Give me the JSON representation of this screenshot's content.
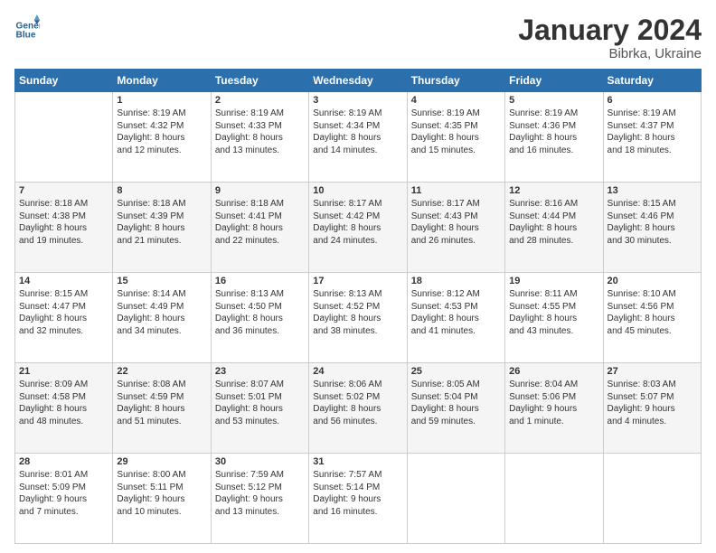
{
  "logo": {
    "line1": "General",
    "line2": "Blue"
  },
  "title": "January 2024",
  "subtitle": "Bibrka, Ukraine",
  "days_of_week": [
    "Sunday",
    "Monday",
    "Tuesday",
    "Wednesday",
    "Thursday",
    "Friday",
    "Saturday"
  ],
  "weeks": [
    [
      {
        "day": "",
        "content": ""
      },
      {
        "day": "1",
        "content": "Sunrise: 8:19 AM\nSunset: 4:32 PM\nDaylight: 8 hours\nand 12 minutes."
      },
      {
        "day": "2",
        "content": "Sunrise: 8:19 AM\nSunset: 4:33 PM\nDaylight: 8 hours\nand 13 minutes."
      },
      {
        "day": "3",
        "content": "Sunrise: 8:19 AM\nSunset: 4:34 PM\nDaylight: 8 hours\nand 14 minutes."
      },
      {
        "day": "4",
        "content": "Sunrise: 8:19 AM\nSunset: 4:35 PM\nDaylight: 8 hours\nand 15 minutes."
      },
      {
        "day": "5",
        "content": "Sunrise: 8:19 AM\nSunset: 4:36 PM\nDaylight: 8 hours\nand 16 minutes."
      },
      {
        "day": "6",
        "content": "Sunrise: 8:19 AM\nSunset: 4:37 PM\nDaylight: 8 hours\nand 18 minutes."
      }
    ],
    [
      {
        "day": "7",
        "content": "Sunrise: 8:18 AM\nSunset: 4:38 PM\nDaylight: 8 hours\nand 19 minutes."
      },
      {
        "day": "8",
        "content": "Sunrise: 8:18 AM\nSunset: 4:39 PM\nDaylight: 8 hours\nand 21 minutes."
      },
      {
        "day": "9",
        "content": "Sunrise: 8:18 AM\nSunset: 4:41 PM\nDaylight: 8 hours\nand 22 minutes."
      },
      {
        "day": "10",
        "content": "Sunrise: 8:17 AM\nSunset: 4:42 PM\nDaylight: 8 hours\nand 24 minutes."
      },
      {
        "day": "11",
        "content": "Sunrise: 8:17 AM\nSunset: 4:43 PM\nDaylight: 8 hours\nand 26 minutes."
      },
      {
        "day": "12",
        "content": "Sunrise: 8:16 AM\nSunset: 4:44 PM\nDaylight: 8 hours\nand 28 minutes."
      },
      {
        "day": "13",
        "content": "Sunrise: 8:15 AM\nSunset: 4:46 PM\nDaylight: 8 hours\nand 30 minutes."
      }
    ],
    [
      {
        "day": "14",
        "content": "Sunrise: 8:15 AM\nSunset: 4:47 PM\nDaylight: 8 hours\nand 32 minutes."
      },
      {
        "day": "15",
        "content": "Sunrise: 8:14 AM\nSunset: 4:49 PM\nDaylight: 8 hours\nand 34 minutes."
      },
      {
        "day": "16",
        "content": "Sunrise: 8:13 AM\nSunset: 4:50 PM\nDaylight: 8 hours\nand 36 minutes."
      },
      {
        "day": "17",
        "content": "Sunrise: 8:13 AM\nSunset: 4:52 PM\nDaylight: 8 hours\nand 38 minutes."
      },
      {
        "day": "18",
        "content": "Sunrise: 8:12 AM\nSunset: 4:53 PM\nDaylight: 8 hours\nand 41 minutes."
      },
      {
        "day": "19",
        "content": "Sunrise: 8:11 AM\nSunset: 4:55 PM\nDaylight: 8 hours\nand 43 minutes."
      },
      {
        "day": "20",
        "content": "Sunrise: 8:10 AM\nSunset: 4:56 PM\nDaylight: 8 hours\nand 45 minutes."
      }
    ],
    [
      {
        "day": "21",
        "content": "Sunrise: 8:09 AM\nSunset: 4:58 PM\nDaylight: 8 hours\nand 48 minutes."
      },
      {
        "day": "22",
        "content": "Sunrise: 8:08 AM\nSunset: 4:59 PM\nDaylight: 8 hours\nand 51 minutes."
      },
      {
        "day": "23",
        "content": "Sunrise: 8:07 AM\nSunset: 5:01 PM\nDaylight: 8 hours\nand 53 minutes."
      },
      {
        "day": "24",
        "content": "Sunrise: 8:06 AM\nSunset: 5:02 PM\nDaylight: 8 hours\nand 56 minutes."
      },
      {
        "day": "25",
        "content": "Sunrise: 8:05 AM\nSunset: 5:04 PM\nDaylight: 8 hours\nand 59 minutes."
      },
      {
        "day": "26",
        "content": "Sunrise: 8:04 AM\nSunset: 5:06 PM\nDaylight: 9 hours\nand 1 minute."
      },
      {
        "day": "27",
        "content": "Sunrise: 8:03 AM\nSunset: 5:07 PM\nDaylight: 9 hours\nand 4 minutes."
      }
    ],
    [
      {
        "day": "28",
        "content": "Sunrise: 8:01 AM\nSunset: 5:09 PM\nDaylight: 9 hours\nand 7 minutes."
      },
      {
        "day": "29",
        "content": "Sunrise: 8:00 AM\nSunset: 5:11 PM\nDaylight: 9 hours\nand 10 minutes."
      },
      {
        "day": "30",
        "content": "Sunrise: 7:59 AM\nSunset: 5:12 PM\nDaylight: 9 hours\nand 13 minutes."
      },
      {
        "day": "31",
        "content": "Sunrise: 7:57 AM\nSunset: 5:14 PM\nDaylight: 9 hours\nand 16 minutes."
      },
      {
        "day": "",
        "content": ""
      },
      {
        "day": "",
        "content": ""
      },
      {
        "day": "",
        "content": ""
      }
    ]
  ]
}
